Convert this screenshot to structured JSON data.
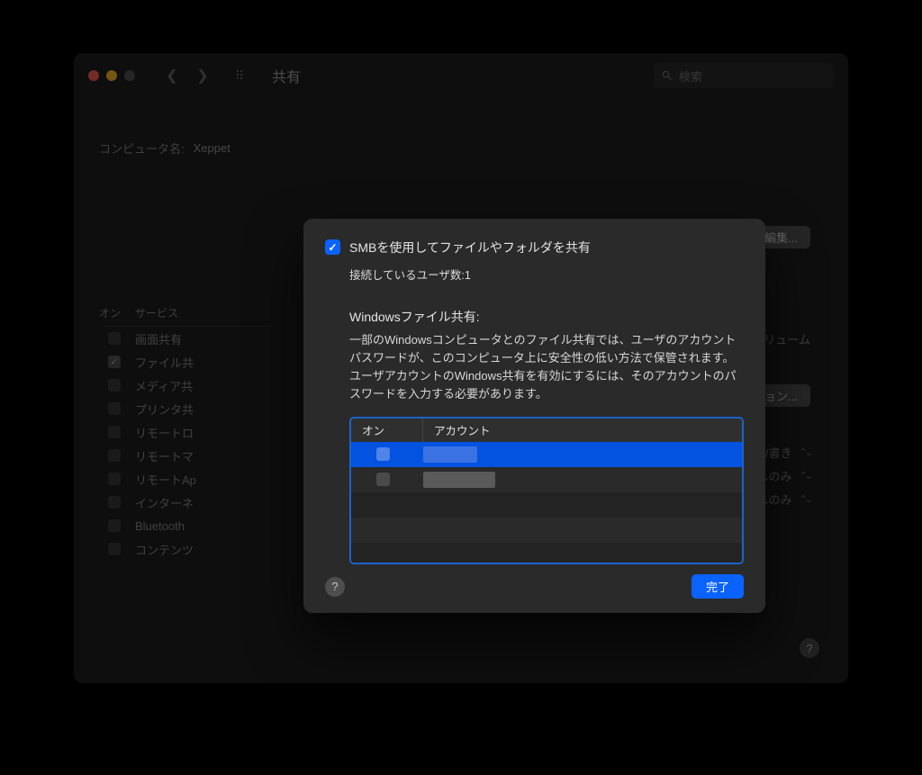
{
  "window": {
    "title": "共有",
    "search_placeholder": "検索"
  },
  "computer": {
    "label": "コンピュータ名:",
    "name": "Xeppet",
    "edit_btn": "編集..."
  },
  "services": {
    "head_on": "オン",
    "head_service": "サービス",
    "items": [
      {
        "on": false,
        "label": "画面共有"
      },
      {
        "on": true,
        "label": "ファイル共"
      },
      {
        "on": false,
        "label": "メディア共"
      },
      {
        "on": false,
        "label": "プリンタ共"
      },
      {
        "on": false,
        "label": "リモートロ"
      },
      {
        "on": false,
        "label": "リモートマ"
      },
      {
        "on": false,
        "label": "リモートAp"
      },
      {
        "on": false,
        "label": "インターネ"
      },
      {
        "on": false,
        "label": "Bluetooth"
      },
      {
        "on": false,
        "label": "コンテンツ"
      }
    ]
  },
  "right": {
    "volumes": "べてのボリューム",
    "options": "オプション...",
    "perm_rw": "読み/書き",
    "perm_ro1": "読み出しのみ",
    "perm_ro2": "読み出しのみ"
  },
  "sheet": {
    "smb_title": "SMBを使用してファイルやフォルダを共有",
    "connected": "接続しているユーザ数:1",
    "wfs_heading": "Windowsファイル共有:",
    "wfs_body": "一部のWindowsコンピュータとのファイル共有では、ユーザのアカウントパスワードが、このコンピュータ上に安全性の低い方法で保管されます。ユーザアカウントのWindows共有を有効にするには、そのアカウントのパスワードを入力する必要があります。",
    "col_on": "オン",
    "col_account": "アカウント",
    "done": "完了"
  }
}
